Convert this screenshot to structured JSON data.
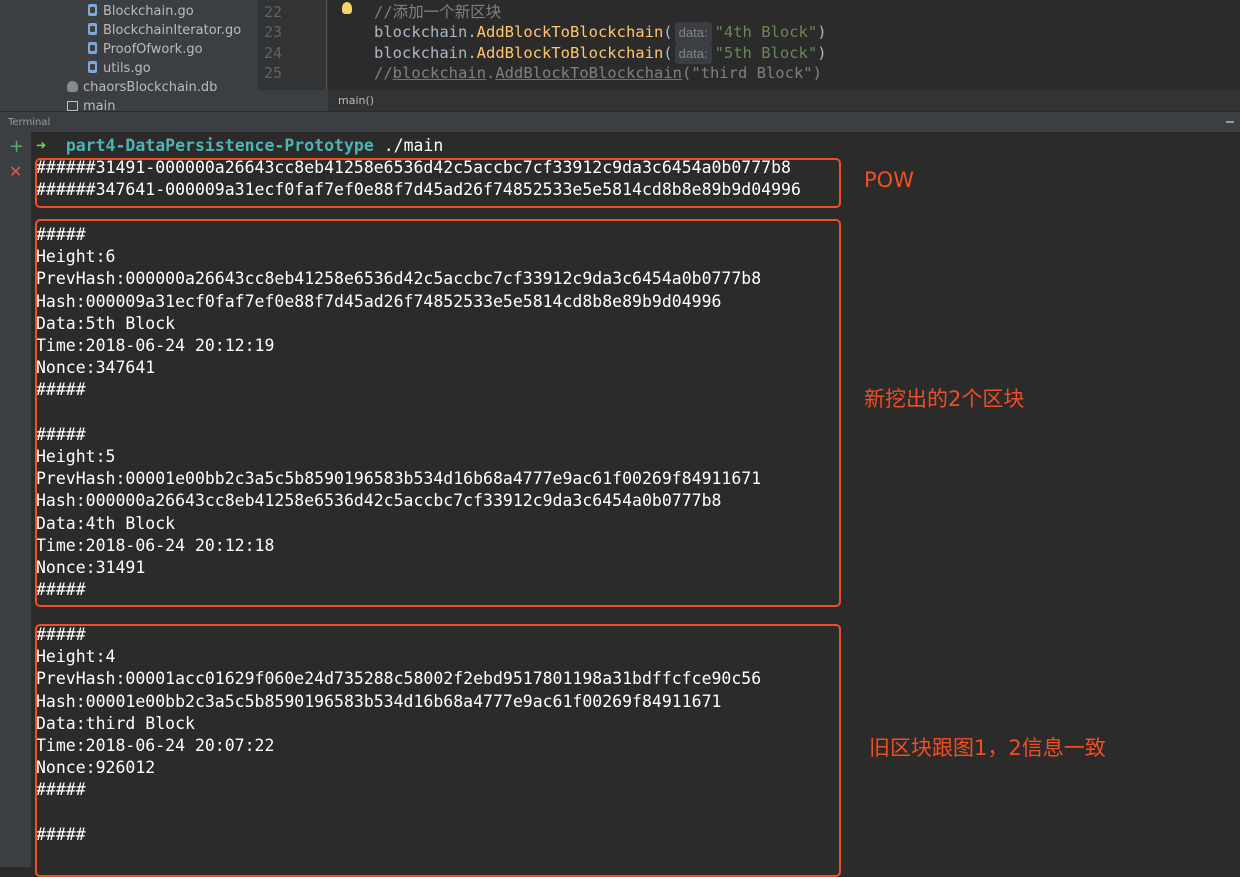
{
  "project_tree": {
    "files": [
      {
        "name": "Blockchain.go",
        "icon": "go-file-icon"
      },
      {
        "name": "BlockchainIterator.go",
        "icon": "go-file-icon"
      },
      {
        "name": "ProofOfwork.go",
        "icon": "go-file-icon"
      },
      {
        "name": "utils.go",
        "icon": "go-file-icon"
      },
      {
        "name": "chaorsBlockchain.db",
        "icon": "database-file-icon"
      },
      {
        "name": "main",
        "icon": "binary-file-icon"
      }
    ]
  },
  "editor": {
    "line_numbers": [
      "22",
      "23",
      "24",
      "25"
    ],
    "line22_comment": "//添加一个新区块",
    "line23": {
      "receiver": "blockchain.",
      "method": "AddBlockToBlockchain",
      "open": "(",
      "hint": "data:",
      "arg": "\"4th Block\"",
      "close": ")"
    },
    "line24": {
      "receiver": "blockchain.",
      "method": "AddBlockToBlockchain",
      "open": "(",
      "hint": "data:",
      "arg": "\"5th Block\"",
      "close": ")"
    },
    "line25": {
      "prefix": "//",
      "underlined": "blockchain",
      "dot": ".",
      "underlined2": "AddBlockToBlockchain",
      "rest": "(\"third Block\")"
    },
    "breadcrumb": "main()"
  },
  "terminal": {
    "title": "Terminal",
    "prompt_arrow": "➜",
    "prompt_dir": "part4-DataPersistence-Prototype",
    "command": " ./main",
    "pow_lines": [
      "######31491-000000a26643cc8eb41258e6536d42c5accbc7cf33912c9da3c6454a0b0777b8",
      "######347641-000009a31ecf0faf7ef0e88f7d45ad26f74852533e5e5814cd8b8e89b9d04996"
    ],
    "new_blocks_lines": [
      "#####",
      "Height:6",
      "PrevHash:000000a26643cc8eb41258e6536d42c5accbc7cf33912c9da3c6454a0b0777b8",
      "Hash:000009a31ecf0faf7ef0e88f7d45ad26f74852533e5e5814cd8b8e89b9d04996",
      "Data:5th Block",
      "Time:2018-06-24 20:12:19",
      "Nonce:347641",
      "#####",
      "",
      "#####",
      "Height:5",
      "PrevHash:00001e00bb2c3a5c5b8590196583b534d16b68a4777e9ac61f00269f84911671",
      "Hash:000000a26643cc8eb41258e6536d42c5accbc7cf33912c9da3c6454a0b0777b8",
      "Data:4th Block",
      "Time:2018-06-24 20:12:18",
      "Nonce:31491",
      "#####"
    ],
    "old_blocks_lines": [
      "#####",
      "Height:4",
      "PrevHash:00001acc01629f060e24d735288c58002f2ebd9517801198a31bdffcfce90c56",
      "Hash:00001e00bb2c3a5c5b8590196583b534d16b68a4777e9ac61f00269f84911671",
      "Data:third Block",
      "Time:2018-06-24 20:07:22",
      "Nonce:926012",
      "#####",
      "",
      "#####"
    ]
  },
  "annotations": {
    "pow_label": "POW",
    "new_blocks_label": "新挖出的2个区块",
    "old_blocks_label": "旧区块跟图1，2信息一致",
    "color": "#f04e23"
  },
  "colors": {
    "terminal_bg": "#2b2b2b",
    "prompt_arrow": "#6fd05f",
    "prompt_dir": "#4eb3b3",
    "method": "#ffc66d",
    "string": "#6a8759"
  }
}
